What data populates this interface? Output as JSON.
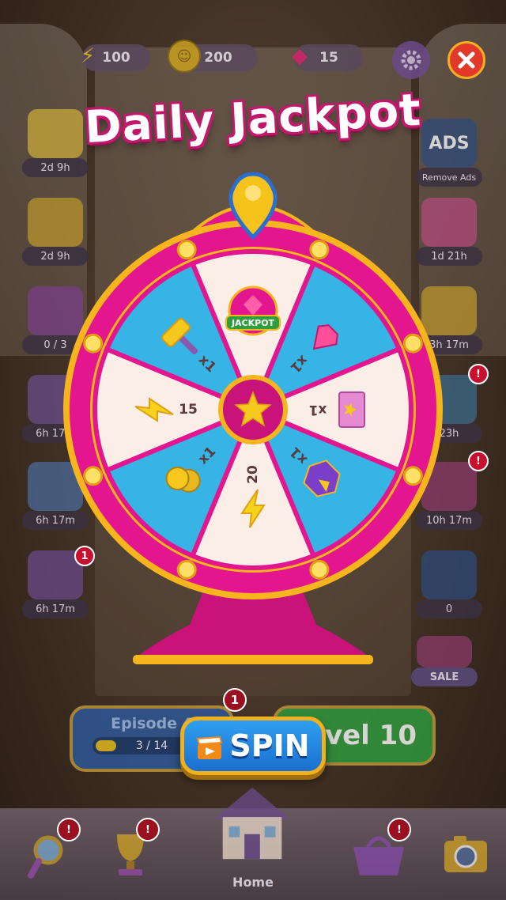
{
  "title": "Daily Jackpot",
  "resources": {
    "energy": "100",
    "coins": "200",
    "gems": "15"
  },
  "left_items": [
    {
      "name": "ticket",
      "timer": "2d 9h"
    },
    {
      "name": "pineapple",
      "timer": "2d 9h"
    },
    {
      "name": "radio",
      "timer": "0 / 3"
    },
    {
      "name": "eiffel",
      "timer": "6h 17m"
    },
    {
      "name": "planet",
      "timer": "6h 17m"
    },
    {
      "name": "window",
      "timer": "6h 17m",
      "badge": "1"
    }
  ],
  "right_items": [
    {
      "name": "ads",
      "timer": "Remove Ads",
      "sticker": "ADS"
    },
    {
      "name": "gifts",
      "timer": "1d 21h"
    },
    {
      "name": "gift-box",
      "timer": "3h 17m"
    },
    {
      "name": "percent",
      "timer": "23h",
      "badge": "!"
    },
    {
      "name": "mini-wheel",
      "timer": "10h 17m",
      "badge": "!"
    },
    {
      "name": "safe",
      "timer": "0"
    },
    {
      "name": "sale",
      "timer": "SALE"
    }
  ],
  "wheel": {
    "segments": [
      {
        "label": "JACKPOT",
        "amount": "",
        "prize": "jackpot"
      },
      {
        "label": "",
        "amount": "x1",
        "prize": "gem"
      },
      {
        "label": "",
        "amount": "x1",
        "prize": "ticket"
      },
      {
        "label": "",
        "amount": "x1",
        "prize": "box"
      },
      {
        "label": "",
        "amount": "20",
        "prize": "energy"
      },
      {
        "label": "",
        "amount": "x1",
        "prize": "coins"
      },
      {
        "label": "",
        "amount": "15",
        "prize": "energy"
      },
      {
        "label": "",
        "amount": "x1",
        "prize": "hammer"
      }
    ],
    "colors": {
      "pink": "#e3168f",
      "gold": "#f6b51c",
      "blue": "#36b4e6",
      "cream": "#fbeee6"
    }
  },
  "episode": {
    "label": "Episode 4",
    "progress": "3 / 14",
    "badge": "1"
  },
  "level": {
    "label": "Level 10"
  },
  "spin_label": "SPIN",
  "nav": {
    "home_label": "Home"
  }
}
